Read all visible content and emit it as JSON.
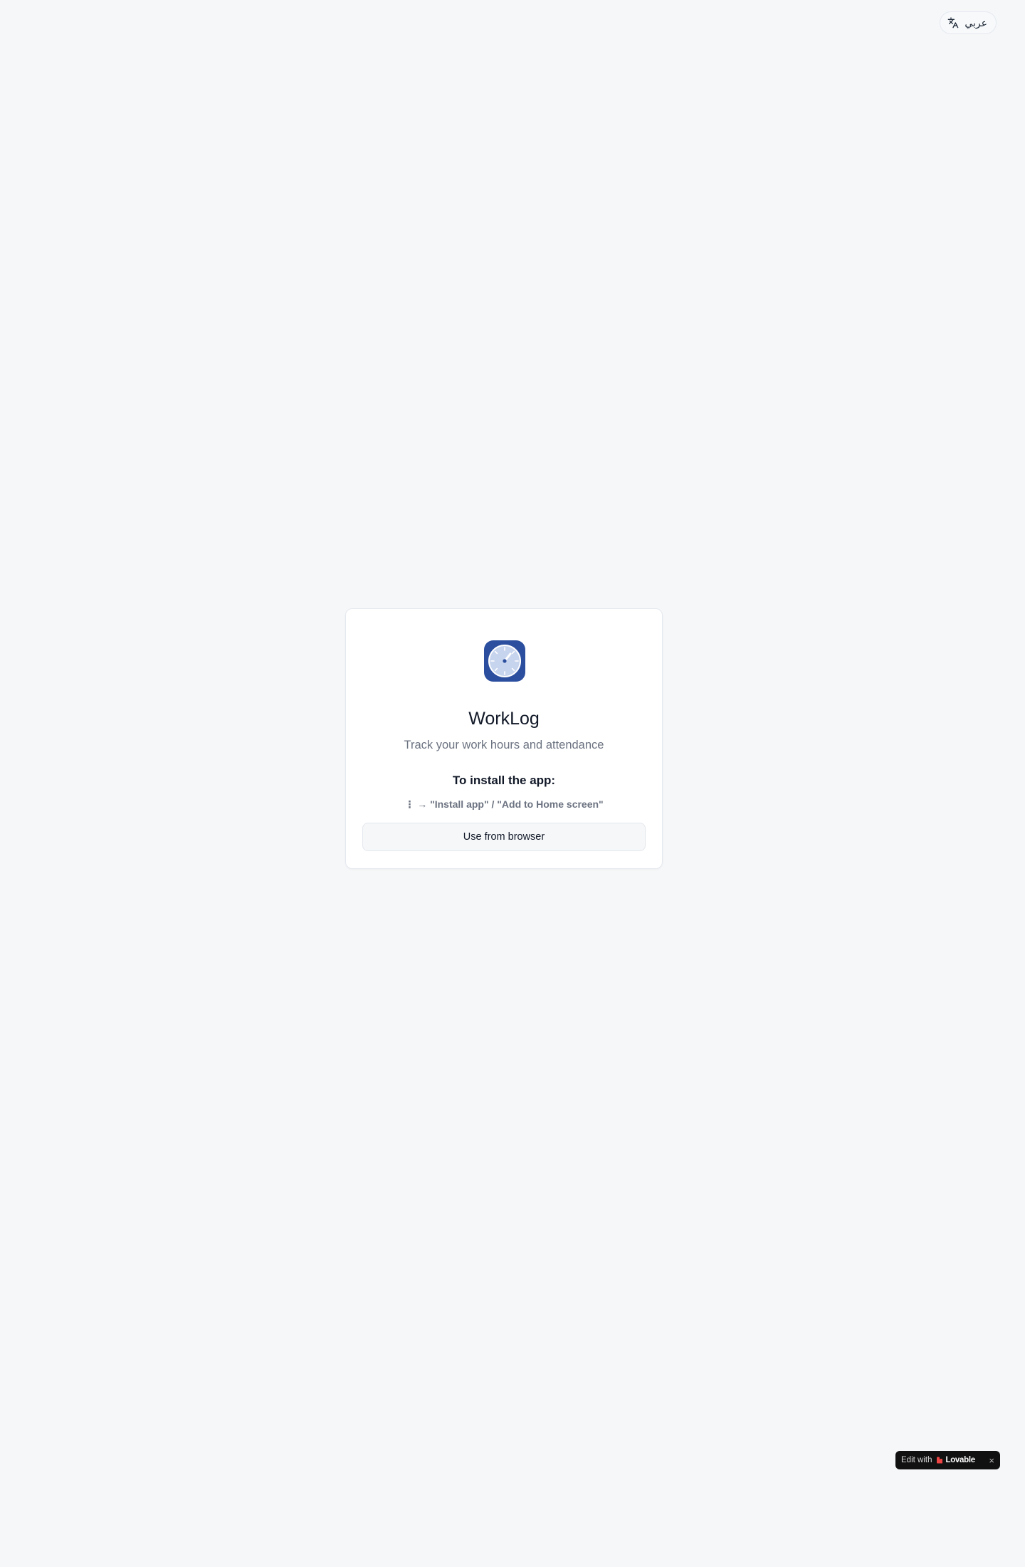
{
  "header": {
    "language_toggle": {
      "label": "عربي",
      "icon": "translate-icon"
    }
  },
  "install_card": {
    "icon": "clock-icon",
    "title": "WorkLog",
    "subtitle": "Track your work hours and attendance",
    "install_heading": "To install the app:",
    "install_steps": "⋮ → \"Install app\" / \"Add to Home screen\"",
    "browser_button_label": "Use from browser"
  },
  "lovable_badge": {
    "prefix": "Edit with",
    "brand": "Lovable",
    "close_symbol": "×"
  },
  "colors": {
    "page_background": "#f5f7f9",
    "app_icon_background": "#2b4e9e",
    "app_icon_face": "#c7d4ee",
    "badge_background": "#111111",
    "badge_heart": "#ef4444"
  }
}
